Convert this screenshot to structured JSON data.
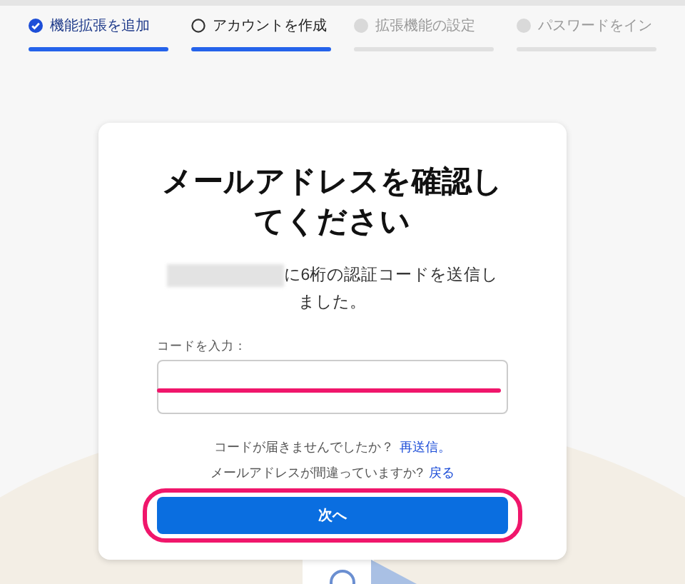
{
  "steps": [
    {
      "label": "機能拡張を追加",
      "completed": true,
      "active": true
    },
    {
      "label": "アカウントを作成",
      "completed": false,
      "active": true
    },
    {
      "label": "拡張機能の設定",
      "completed": false,
      "active": false
    },
    {
      "label": "パスワードをイン",
      "completed": false,
      "active": false
    }
  ],
  "card": {
    "title": "メールアドレスを確認してください",
    "email_redacted": true,
    "message": "に6桁の認証コードを送信しました。",
    "field": {
      "label": "コードを入力：",
      "highlighted": true
    },
    "resend": {
      "text": "コードが届きませんでしたか？",
      "link": "再送信。"
    },
    "back": {
      "text": "メールアドレスが間違っていますか?",
      "link": "戻る"
    },
    "button": {
      "label": "次へ",
      "highlighted": true
    }
  }
}
